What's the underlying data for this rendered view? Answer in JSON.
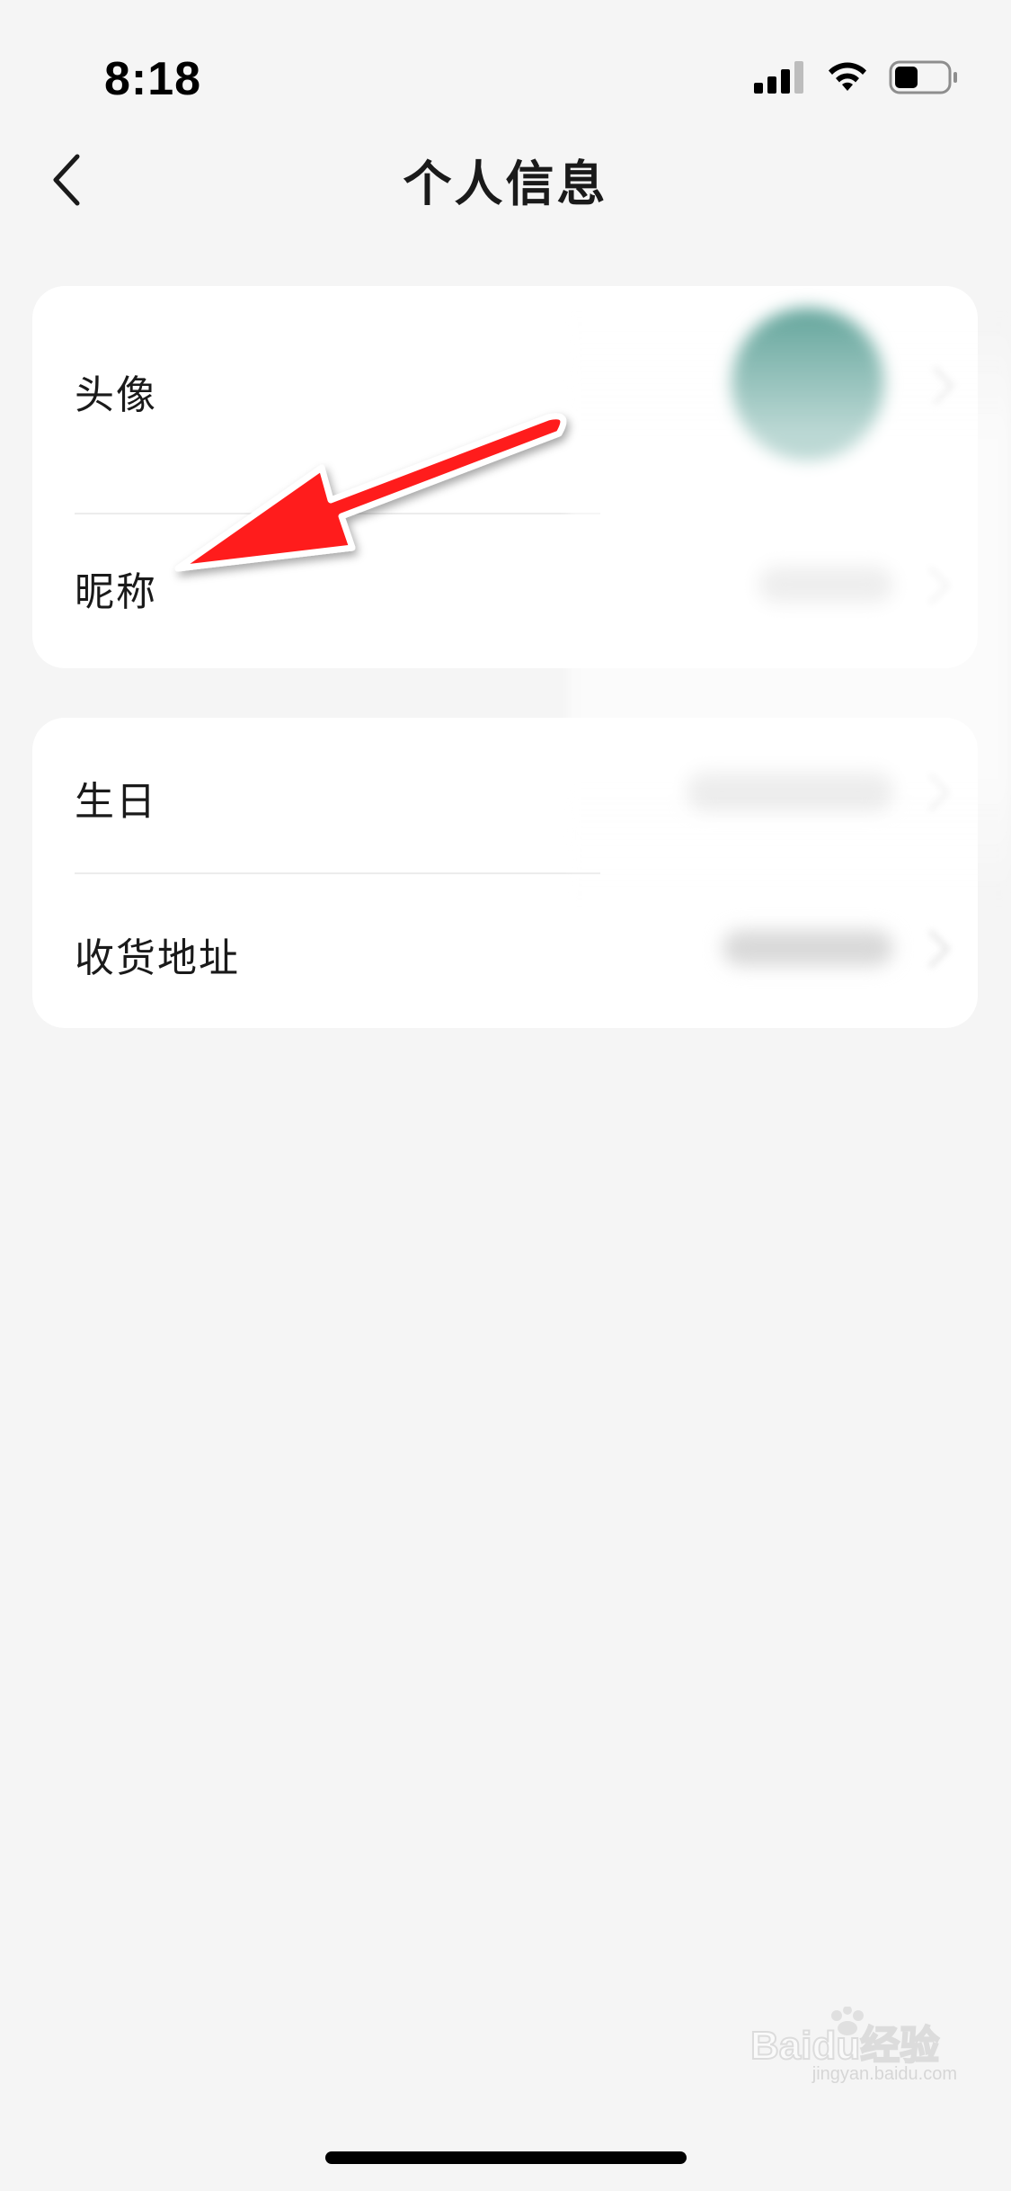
{
  "status_bar": {
    "time": "8:18",
    "signal_icon": "cellular-signal-icon",
    "wifi_icon": "wifi-icon",
    "battery_icon": "battery-icon",
    "battery_level": 0.45
  },
  "nav": {
    "back_icon": "chevron-left-icon",
    "title": "个人信息"
  },
  "sections": [
    {
      "rows": [
        {
          "label": "头像",
          "value_type": "avatar"
        },
        {
          "label": "昵称",
          "value_type": "blurred-text"
        }
      ]
    },
    {
      "rows": [
        {
          "label": "生日",
          "value_type": "blurred-text"
        },
        {
          "label": "收货地址",
          "value_type": "blurred-text"
        }
      ]
    }
  ],
  "annotation": {
    "type": "arrow",
    "color": "#ff1a1a",
    "points_to": "昵称"
  },
  "watermark": {
    "logo": "Baidu经验",
    "url": "jingyan.baidu.com"
  },
  "colors": {
    "background": "#f5f5f5",
    "card": "#ffffff",
    "avatar": "#6aa9a0",
    "arrow": "#ff1a1a"
  }
}
